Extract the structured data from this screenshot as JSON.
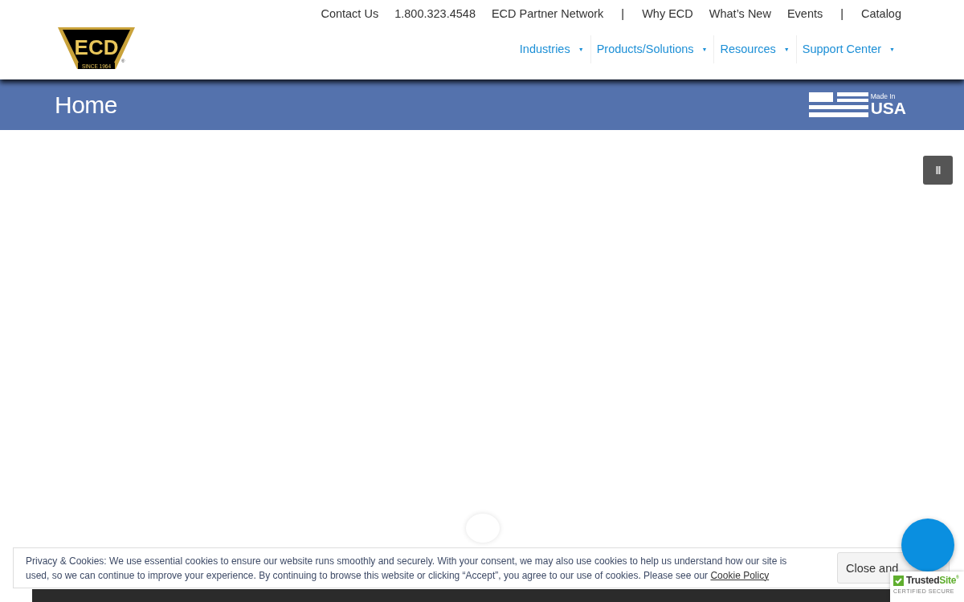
{
  "logo": {
    "letters": "ECD",
    "since": "SINCE 1964",
    "mark": "®"
  },
  "top_links": [
    {
      "label": "Contact Us",
      "kind": "link"
    },
    {
      "label": "1.800.323.4548",
      "kind": "link"
    },
    {
      "label": "ECD Partner Network",
      "kind": "link"
    },
    {
      "label": "|",
      "kind": "separator"
    },
    {
      "label": "Why ECD",
      "kind": "link"
    },
    {
      "label": "What’s New",
      "kind": "link"
    },
    {
      "label": "Events",
      "kind": "link"
    },
    {
      "label": "|",
      "kind": "separator"
    },
    {
      "label": "Catalog",
      "kind": "link"
    }
  ],
  "main_nav": [
    {
      "label": "Industries",
      "caret": "▼"
    },
    {
      "label": "Products/Solutions",
      "caret": "▼"
    },
    {
      "label": "Resources",
      "caret": "▼"
    },
    {
      "label": "Support Center",
      "caret": "▼"
    }
  ],
  "banner": {
    "title": "Home",
    "badge_small": "Made In",
    "badge_large": "USA"
  },
  "slider": {
    "pause_button": "II"
  },
  "cookie_notice": {
    "text": "Privacy & Cookies: We use essential cookies to ensure our website runs smoothly and securely. With your consent, we may also use cookies to help us understand how our site is used, so we can continue to improve your experience. By continuing to browse this website or clicking “Accept”, you agree to our use of cookies. Please see our",
    "link": "Cookie Policy",
    "button": "Close and"
  },
  "trust_badge": {
    "name_first": "Trusted",
    "name_second": "Site",
    "mark": "®",
    "subtitle": "CERTIFIED SECURE"
  }
}
